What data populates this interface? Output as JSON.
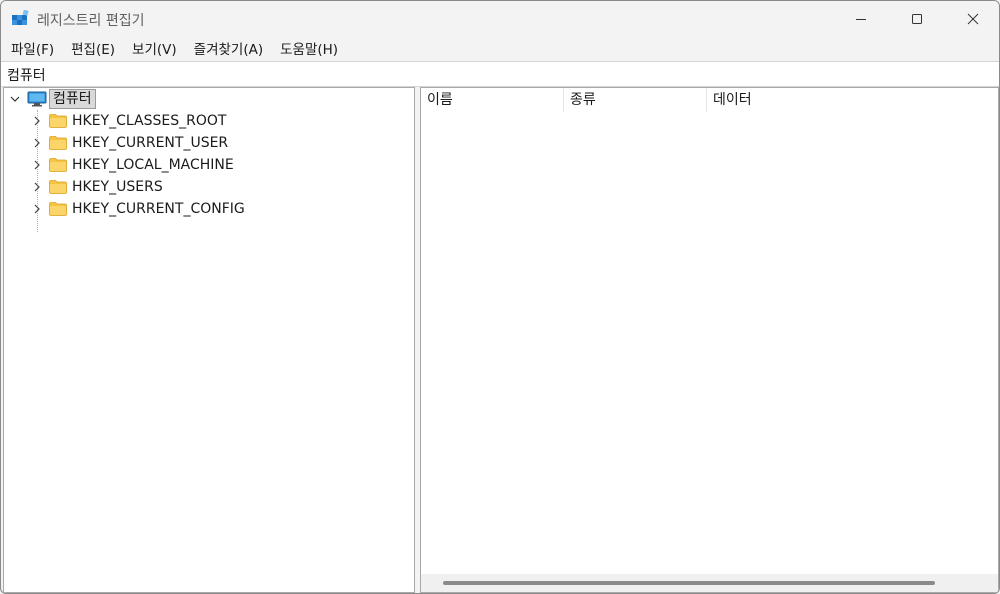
{
  "window": {
    "title": "레지스트리 편집기"
  },
  "menu": [
    {
      "label": "파일(F)"
    },
    {
      "label": "편집(E)"
    },
    {
      "label": "보기(V)"
    },
    {
      "label": "즐겨찾기(A)"
    },
    {
      "label": "도움말(H)"
    }
  ],
  "address": {
    "path": "컴퓨터"
  },
  "tree": {
    "root": {
      "label": "컴퓨터",
      "icon": "computer-icon",
      "expanded": true,
      "selected": true
    },
    "hives": [
      {
        "label": "HKEY_CLASSES_ROOT",
        "icon": "folder-icon"
      },
      {
        "label": "HKEY_CURRENT_USER",
        "icon": "folder-icon"
      },
      {
        "label": "HKEY_LOCAL_MACHINE",
        "icon": "folder-icon"
      },
      {
        "label": "HKEY_USERS",
        "icon": "folder-icon"
      },
      {
        "label": "HKEY_CURRENT_CONFIG",
        "icon": "folder-icon"
      }
    ]
  },
  "list": {
    "columns": [
      {
        "label": "이름"
      },
      {
        "label": "종류"
      },
      {
        "label": "데이터"
      }
    ]
  },
  "colors": {
    "folder": "#f6c344",
    "monitor": "#2a8ad4",
    "selection": "#d9d9d9"
  }
}
